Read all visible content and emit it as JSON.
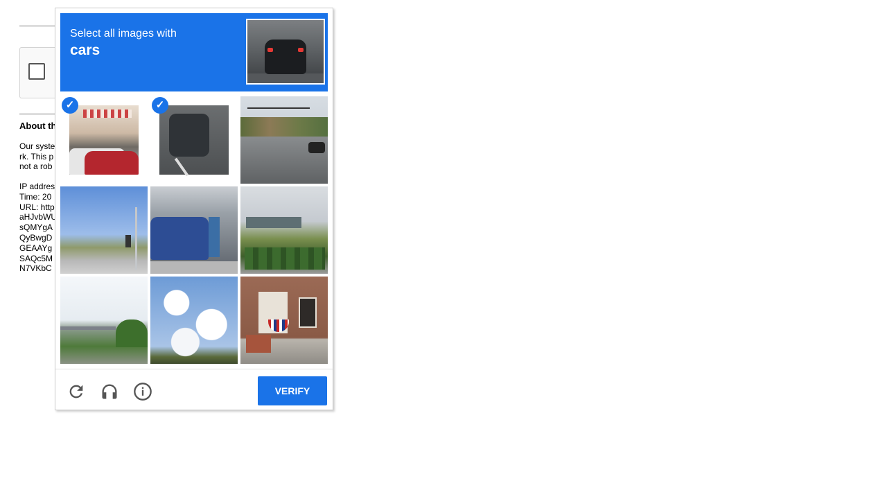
{
  "background_page": {
    "about_heading": "About th",
    "paragraph1": [
      "Our syste",
      "rk. This p",
      "not a rob"
    ],
    "paragraph2": [
      "IP addres",
      "Time: 20",
      "URL: http",
      "aHJvbWU",
      "sQMYgA",
      "QyBwgD",
      "GEAAYg",
      "SAQc5M",
      "N7VKbC"
    ]
  },
  "captcha": {
    "instruction": "Select all images with",
    "target": "cars",
    "tiles": [
      {
        "label": "house-with-cars",
        "selected": true
      },
      {
        "label": "car-on-road",
        "selected": true
      },
      {
        "label": "road-traffic-light",
        "selected": false
      },
      {
        "label": "sky-traffic-light",
        "selected": false
      },
      {
        "label": "parking-lot-cars",
        "selected": false
      },
      {
        "label": "gate-hedges",
        "selected": false
      },
      {
        "label": "bridge-field",
        "selected": false
      },
      {
        "label": "clouds-sky",
        "selected": false
      },
      {
        "label": "brick-house-flag",
        "selected": false
      }
    ],
    "check_glyph": "✓",
    "footer": {
      "reload_icon": "reload-icon",
      "audio_icon": "headphones-icon",
      "info_icon": "info-icon",
      "verify_label": "VERIFY"
    },
    "colors": {
      "accent": "#1a73e8"
    }
  }
}
